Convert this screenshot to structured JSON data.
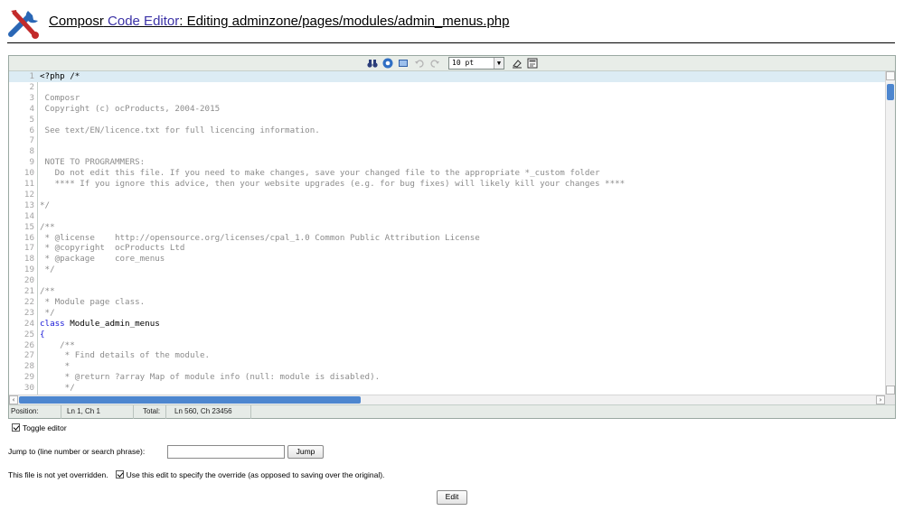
{
  "header": {
    "title_part1": "Composr",
    "title_part2": "Code Editor",
    "title_part3": ": Editing adminzone/pages/modules/admin_menus.php",
    "logo_icon": "wrench-screwdriver-icon"
  },
  "toolbar": {
    "font_size": "10 pt",
    "icons": [
      "search-binoculars-icon",
      "help-icon",
      "fullscreen-icon",
      "undo-icon",
      "redo-icon",
      "eraser-icon",
      "syntax-toggle-icon"
    ]
  },
  "editor": {
    "lines": [
      {
        "n": "1",
        "t": "<?php /*"
      },
      {
        "n": "2",
        "t": ""
      },
      {
        "n": "3",
        "t": " Composr"
      },
      {
        "n": "4",
        "t": " Copyright (c) ocProducts, 2004-2015"
      },
      {
        "n": "5",
        "t": ""
      },
      {
        "n": "6",
        "t": " See text/EN/licence.txt for full licencing information."
      },
      {
        "n": "7",
        "t": ""
      },
      {
        "n": "8",
        "t": ""
      },
      {
        "n": "9",
        "t": " NOTE TO PROGRAMMERS:"
      },
      {
        "n": "10",
        "t": "   Do not edit this file. If you need to make changes, save your changed file to the appropriate *_custom folder"
      },
      {
        "n": "11",
        "t": "   **** If you ignore this advice, then your website upgrades (e.g. for bug fixes) will likely kill your changes ****"
      },
      {
        "n": "12",
        "t": ""
      },
      {
        "n": "13",
        "t": "*/"
      },
      {
        "n": "14",
        "t": ""
      },
      {
        "n": "15",
        "t": "/**"
      },
      {
        "n": "16",
        "t": " * @license    http://opensource.org/licenses/cpal_1.0 Common Public Attribution License"
      },
      {
        "n": "17",
        "t": " * @copyright  ocProducts Ltd"
      },
      {
        "n": "18",
        "t": " * @package    core_menus"
      },
      {
        "n": "19",
        "t": " */"
      },
      {
        "n": "20",
        "t": ""
      },
      {
        "n": "21",
        "t": "/**"
      },
      {
        "n": "22",
        "t": " * Module page class."
      },
      {
        "n": "23",
        "t": " */"
      },
      {
        "n": "24",
        "kw": "class",
        "id": " Module_admin_menus"
      },
      {
        "n": "25",
        "kw": "{"
      },
      {
        "n": "26",
        "t": "    /**"
      },
      {
        "n": "27",
        "t": "     * Find details of the module."
      },
      {
        "n": "28",
        "t": "     *"
      },
      {
        "n": "29",
        "t": "     * @return ?array Map of module info (null: module is disabled)."
      },
      {
        "n": "30",
        "t": "     */"
      }
    ]
  },
  "statusbar": {
    "position_label": "Position:",
    "position_value": "Ln 1, Ch 1",
    "total_label": "Total:",
    "total_value": "Ln 560, Ch 23456"
  },
  "form": {
    "toggle_editor_label": "Toggle editor",
    "toggle_editor_checked": true,
    "jump_label": "Jump to (line number or search phrase):",
    "jump_value": "",
    "jump_button": "Jump",
    "override_status": "This file is not yet overridden.",
    "override_checkbox_label": "Use this edit to specify the override (as opposed to saving over the original).",
    "override_checked": true,
    "edit_button": "Edit"
  }
}
